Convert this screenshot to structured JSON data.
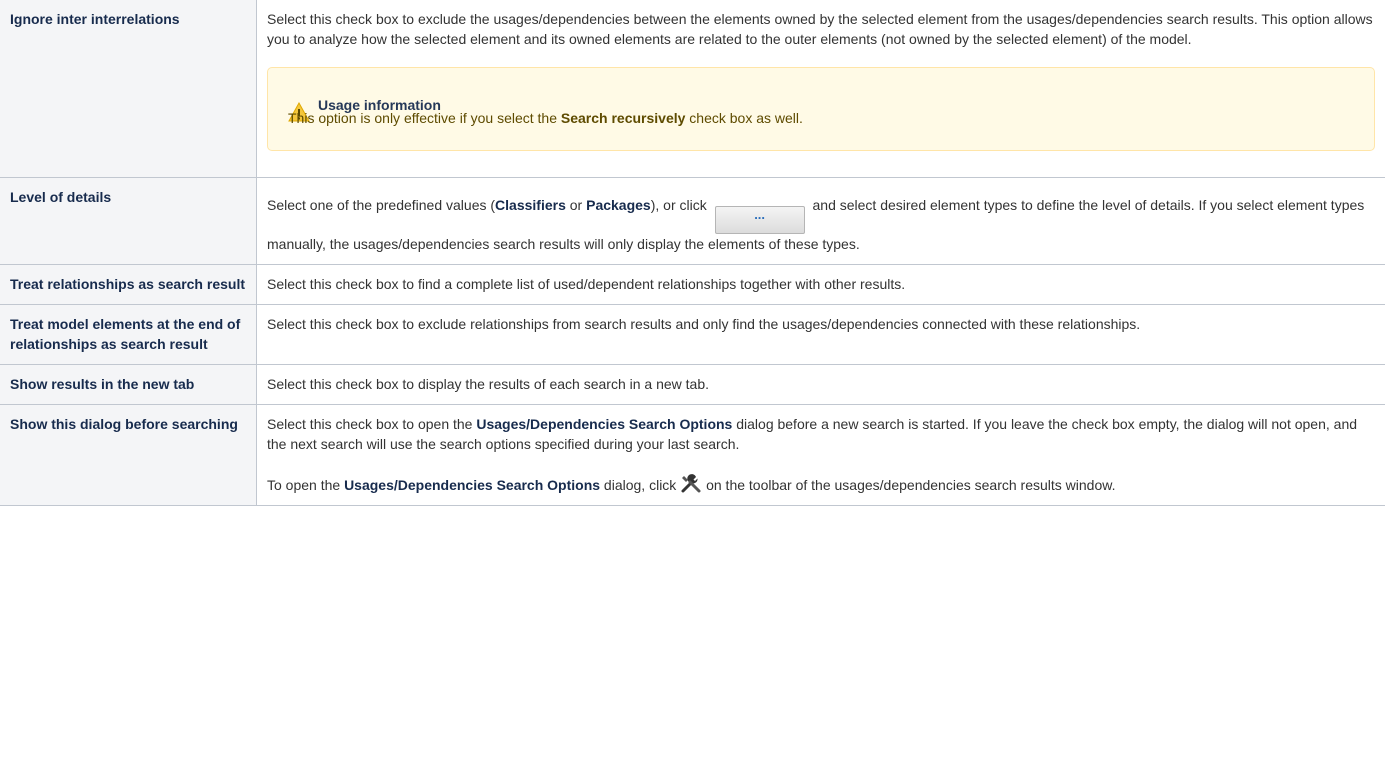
{
  "rows": [
    {
      "name": "Ignore inter interrelations",
      "desc": "Select this check box to exclude the usages/dependencies between the elements owned by the selected element from the usages/dependencies search results. This option allows you to analyze how the selected element and its owned elements are related to the outer elements (not owned by the selected element) of the model.",
      "note": {
        "title": "Usage information",
        "text_before": "This option is only effective if you select the ",
        "text_bold": "Search recursively",
        "text_after": " check box as well."
      }
    },
    {
      "name": "Level of details",
      "desc_a": "Select one of the predefined values (",
      "desc_b1": "Classifiers",
      "desc_c": " or ",
      "desc_b2": "Packages",
      "desc_d": "), or click ",
      "button_label": "...",
      "desc_e": " and select desired element types to define the level of details. If you select element types manually, the usages/dependencies search results will only display the elements of these types."
    },
    {
      "name": "Treat relationships as search result",
      "desc": "Select this check box to find a complete list of used/dependent relationships together with other results."
    },
    {
      "name": "Treat model elements at the end of relationships as search result",
      "desc": "Select this check box to exclude relationships from search results and only find the usages/dependencies connected with these relationships."
    },
    {
      "name": "Show results in the new tab",
      "desc": "Select this check box to display the results of each search in a new tab."
    },
    {
      "name": "Show this dialog before searching",
      "p1_a": "Select this check box to open the ",
      "p1_b": "Usages/Dependencies Search Options",
      "p1_c": " dialog before a new search is started. If you leave the check box empty, the dialog will not open, and the next search will use the search options specified during your last search.",
      "p2_a": "To open the ",
      "p2_b": "Usages/Dependencies Search Options",
      "p2_c": " dialog, click ",
      "p2_icon": "wrench-screwdriver-icon",
      "p2_d": " on the toolbar of the usages/dependencies search results window."
    }
  ]
}
